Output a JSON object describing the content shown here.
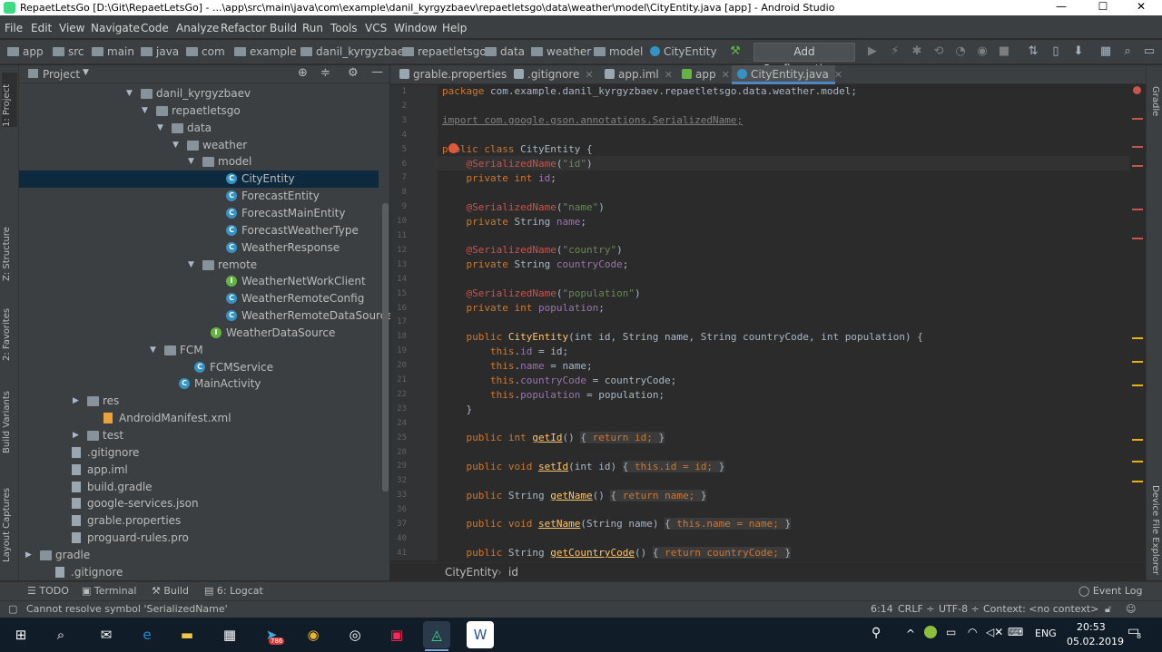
{
  "window": {
    "title": "RepaetLetsGo [D:\\Git\\RepaetLetsGo] - ...\\app\\src\\main\\java\\com\\example\\danil_kyrgyzbaev\\repaetletsgo\\data\\weather\\model\\CityEntity.java [app] - Android Studio",
    "minimize": "—",
    "maximize": "☐",
    "close": "✕"
  },
  "menu": [
    "File",
    "Edit",
    "View",
    "Navigate",
    "Code",
    "Analyze",
    "Refactor",
    "Build",
    "Run",
    "Tools",
    "VCS",
    "Window",
    "Help"
  ],
  "navbar": {
    "crumbs": [
      "app",
      "src",
      "main",
      "java",
      "com",
      "example",
      "danil_kyrgyzbaev",
      "repaetletsgo",
      "data",
      "weather",
      "model",
      "CityEntity"
    ],
    "add_config": "Add Configuration..."
  },
  "left_tools": [
    "1: Project",
    "Z: Structure",
    "2: Favorites",
    "Build Variants",
    "Layout Captures"
  ],
  "right_tools": [
    "Gradle",
    "Device File Explorer"
  ],
  "project_panel": {
    "title": "Project",
    "tree": [
      {
        "label": "danil_kyrgyzbaev",
        "type": "pkg",
        "arrow": "▼"
      },
      {
        "label": "repaetletsgo",
        "type": "pkg",
        "arrow": "▼"
      },
      {
        "label": "data",
        "type": "pkg",
        "arrow": "▼"
      },
      {
        "label": "weather",
        "type": "pkg",
        "arrow": "▼"
      },
      {
        "label": "model",
        "type": "pkg",
        "arrow": "▼"
      },
      {
        "label": "CityEntity",
        "type": "cls",
        "arrow": ""
      },
      {
        "label": "ForecastEntity",
        "type": "cls",
        "arrow": ""
      },
      {
        "label": "ForecastMainEntity",
        "type": "cls",
        "arrow": ""
      },
      {
        "label": "ForecastWeatherType",
        "type": "cls",
        "arrow": ""
      },
      {
        "label": "WeatherResponse",
        "type": "cls",
        "arrow": ""
      },
      {
        "label": "remote",
        "type": "pkg",
        "arrow": "▼"
      },
      {
        "label": "WeatherNetWorkClient",
        "type": "intf",
        "arrow": ""
      },
      {
        "label": "WeatherRemoteConfig",
        "type": "cls",
        "arrow": ""
      },
      {
        "label": "WeatherRemoteDataSource",
        "type": "cls",
        "arrow": ""
      },
      {
        "label": "WeatherDataSource",
        "type": "intf",
        "arrow": ""
      },
      {
        "label": "FCM",
        "type": "pkg",
        "arrow": "▼"
      },
      {
        "label": "FCMService",
        "type": "cls",
        "arrow": ""
      },
      {
        "label": "MainActivity",
        "type": "cls",
        "arrow": ""
      },
      {
        "label": "res",
        "type": "folder",
        "arrow": "▶"
      },
      {
        "label": "AndroidManifest.xml",
        "type": "xml",
        "arrow": ""
      },
      {
        "label": "test",
        "type": "folder",
        "arrow": "▶"
      },
      {
        "label": ".gitignore",
        "type": "file",
        "arrow": ""
      },
      {
        "label": "app.iml",
        "type": "file",
        "arrow": ""
      },
      {
        "label": "build.gradle",
        "type": "file",
        "arrow": ""
      },
      {
        "label": "google-services.json",
        "type": "file",
        "arrow": ""
      },
      {
        "label": "grable.properties",
        "type": "file",
        "arrow": ""
      },
      {
        "label": "proguard-rules.pro",
        "type": "file",
        "arrow": ""
      },
      {
        "label": "gradle",
        "type": "folder",
        "arrow": "▶"
      },
      {
        "label": ".gitignore",
        "type": "file",
        "arrow": ""
      }
    ]
  },
  "editor_tabs": [
    {
      "label": "grable.properties",
      "active": false
    },
    {
      "label": ".gitignore",
      "active": false
    },
    {
      "label": "app.iml",
      "active": false
    },
    {
      "label": "app",
      "active": false
    },
    {
      "label": "CityEntity.java",
      "active": true
    }
  ],
  "code": {
    "line_numbers": [
      "1",
      "2",
      "3",
      "4",
      "5",
      "6",
      "7",
      "8",
      "9",
      "10",
      "11",
      "12",
      "13",
      "14",
      "15",
      "16",
      "17",
      "18",
      "19",
      "20",
      "21",
      "22",
      "23",
      "24",
      "25",
      "28",
      "29",
      "32",
      "33",
      "36",
      "37",
      "40",
      "41"
    ],
    "package": "com.example.danil_kyrgyzbaev.repaetletsgo.data.weather.model;",
    "import": "import com.google.gson.annotations.SerializedName;",
    "class_name": "CityEntity",
    "fields": [
      {
        "annotation": "@SerializedName",
        "key": "\"id\"",
        "type": "int",
        "name": "id"
      },
      {
        "annotation": "@SerializedName",
        "key": "\"name\"",
        "type": "String",
        "name": "name"
      },
      {
        "annotation": "@SerializedName",
        "key": "\"country\"",
        "type": "String",
        "name": "countryCode"
      },
      {
        "annotation": "@SerializedName",
        "key": "\"population\"",
        "type": "int",
        "name": "population"
      }
    ],
    "constructor_params": "(int id, String name, String countryCode, int population) {",
    "ctor_body": [
      "id = id;",
      "name = name;",
      "countryCode = countryCode;",
      "population = population;"
    ],
    "methods": [
      {
        "ret": "int",
        "name": "getId",
        "params": "()",
        "body": " return id; "
      },
      {
        "ret": "void",
        "name": "setId",
        "params": "(int id)",
        "body": " this.id = id; "
      },
      {
        "ret": "String",
        "name": "getName",
        "params": "()",
        "body": " return name; "
      },
      {
        "ret": "void",
        "name": "setName",
        "params": "(String name)",
        "body": " this.name = name; "
      },
      {
        "ret": "String",
        "name": "getCountryCode",
        "params": "()",
        "body": " return countryCode; "
      }
    ]
  },
  "editor_breadcrumb": [
    "CityEntity",
    "id"
  ],
  "bottom_tabs": [
    "TODO",
    "Terminal",
    "Build",
    "6: Logcat"
  ],
  "event_log": "Event Log",
  "status": {
    "message": "Cannot resolve symbol 'SerializedName'",
    "position": "6:14",
    "line_sep": "CRLF ÷",
    "encoding": "UTF-8 ÷",
    "context": "Context: <no context>"
  },
  "taskbar": {
    "time": "20:53",
    "date": "05.02.2019",
    "lang": "ENG",
    "telegram_badge": "786",
    "notif_count": "8"
  }
}
